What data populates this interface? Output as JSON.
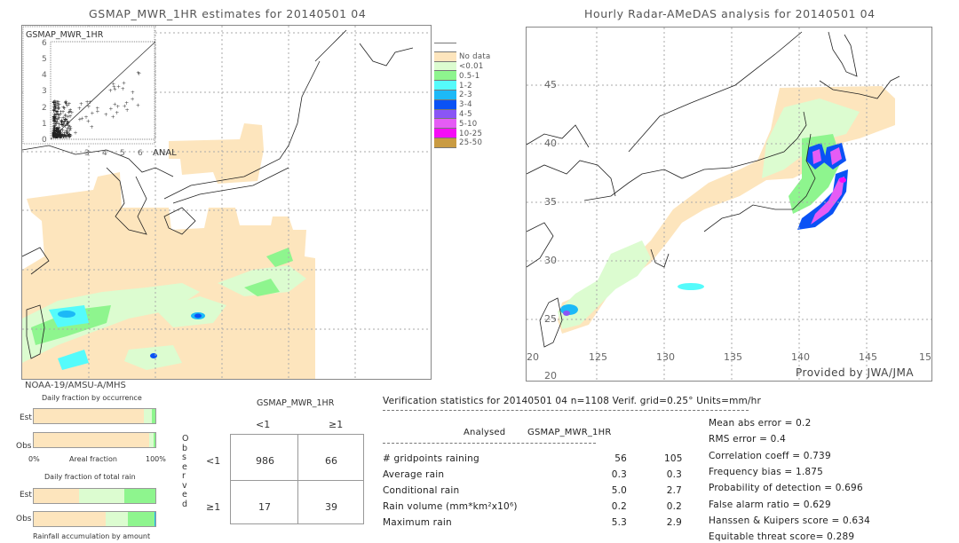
{
  "left_panel": {
    "title": "GSMAP_MWR_1HR estimates for 20140501 04",
    "scatter_label": "GSMAP_MWR_1HR",
    "scatter_x_label": "ANAL",
    "scatter_ticks": [
      "0",
      "1",
      "2",
      "3",
      "4",
      "5",
      "6"
    ],
    "sensor_label": "NOAA-19/AMSU-A/MHS"
  },
  "right_panel": {
    "title": "Hourly Radar-AMeDAS analysis for 20140501 04",
    "lat_ticks": [
      "45",
      "40",
      "35",
      "30",
      "25",
      "20"
    ],
    "lon_ticks": [
      "20",
      "125",
      "130",
      "135",
      "140",
      "145",
      "15"
    ],
    "credit": "Provided by JWA/JMA"
  },
  "legend": {
    "items": [
      {
        "label": "",
        "color": "#ffffff"
      },
      {
        "label": "No data",
        "color": "#fde5bd"
      },
      {
        "label": "<0.01",
        "color": "#dcfcd0"
      },
      {
        "label": "0.5-1",
        "color": "#8ef58e"
      },
      {
        "label": "1-2",
        "color": "#55fbfb"
      },
      {
        "label": "2-3",
        "color": "#1cb9f7"
      },
      {
        "label": "3-4",
        "color": "#0a52f5"
      },
      {
        "label": "4-5",
        "color": "#8a55f5"
      },
      {
        "label": "5-10",
        "color": "#e55cf5"
      },
      {
        "label": "10-25",
        "color": "#f50cf5"
      },
      {
        "label": "25-50",
        "color": "#c99b42"
      }
    ]
  },
  "fraction_charts": {
    "occurrence_title": "Daily fraction by occurrence",
    "total_rain_title": "Daily fraction of total rain",
    "est_label": "Est",
    "obs_label": "Obs",
    "axis_left": "0%",
    "axis_mid": "Areal fraction",
    "axis_right": "100%",
    "footer": "Rainfall accumulation by amount",
    "occurrence_est": [
      {
        "pct": 90.5,
        "color": "#fde5bd"
      },
      {
        "pct": 6.5,
        "color": "#dcfcd0"
      },
      {
        "pct": 3.0,
        "color": "#8ef58e"
      }
    ],
    "occurrence_obs": [
      {
        "pct": 95.0,
        "color": "#fde5bd"
      },
      {
        "pct": 3.5,
        "color": "#dcfcd0"
      },
      {
        "pct": 1.5,
        "color": "#8ef58e"
      }
    ],
    "rain_est": [
      {
        "pct": 37.0,
        "color": "#fde5bd"
      },
      {
        "pct": 37.5,
        "color": "#dcfcd0"
      },
      {
        "pct": 25.5,
        "color": "#8ef58e"
      }
    ],
    "rain_obs": [
      {
        "pct": 59.0,
        "color": "#fde5bd"
      },
      {
        "pct": 18.5,
        "color": "#dcfcd0"
      },
      {
        "pct": 21.5,
        "color": "#8ef58e"
      },
      {
        "pct": 1.0,
        "color": "#1cb9f7"
      }
    ]
  },
  "contingency": {
    "model_label": "GSMAP_MWR_1HR",
    "col_labels": [
      "<1",
      "≥1"
    ],
    "row_labels": [
      "<1",
      "≥1"
    ],
    "observed_label": "Observed",
    "cells": [
      [
        "986",
        "66"
      ],
      [
        "17",
        "39"
      ]
    ]
  },
  "verification": {
    "header": "Verification statistics for 20140501 04   n=1108   Verif. grid=0.25°   Units=mm/hr",
    "col_analysed": "Analysed",
    "col_model": "GSMAP_MWR_1HR",
    "rows": [
      {
        "label": "# gridpoints raining",
        "analysed": "56",
        "model": "105"
      },
      {
        "label": "Average rain",
        "analysed": "0.3",
        "model": "0.3"
      },
      {
        "label": "Conditional rain",
        "analysed": "5.0",
        "model": "2.7"
      },
      {
        "label": "Rain volume (mm*km²x10⁶)",
        "analysed": "0.2",
        "model": "0.2"
      },
      {
        "label": "Maximum rain",
        "analysed": "5.3",
        "model": "2.9"
      }
    ],
    "scores": [
      "Mean abs error = 0.2",
      "RMS error = 0.4",
      "Correlation coeff = 0.739",
      "Frequency bias = 1.875",
      "Probability of detection = 0.696",
      "False alarm ratio = 0.629",
      "Hanssen & Kuipers score = 0.634",
      "Equitable threat score= 0.289"
    ]
  }
}
